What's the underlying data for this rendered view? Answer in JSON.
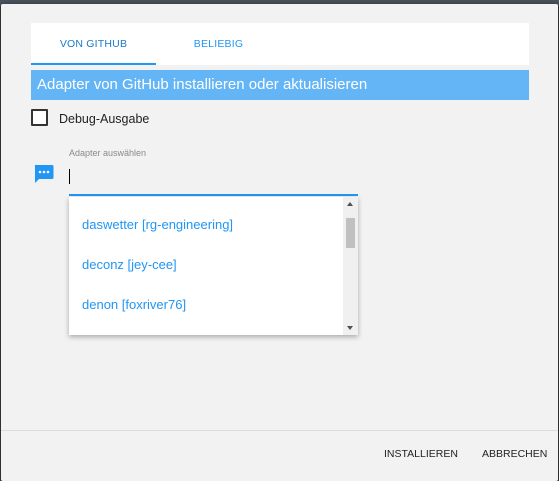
{
  "tabs": [
    {
      "label": "VON GITHUB",
      "active": true
    },
    {
      "label": "BELIEBIG",
      "active": false
    }
  ],
  "section": {
    "title": "Adapter von GitHub installieren oder aktualisieren"
  },
  "debug": {
    "label": "Debug-Ausgabe",
    "checked": false
  },
  "adapter_select": {
    "label": "Adapter auswählen",
    "value": "",
    "icon": "chat-bubble-icon",
    "options": [
      "daswetter [rg-engineering]",
      "deconz [jey-cee]",
      "denon [foxriver76]"
    ]
  },
  "footer": {
    "install_label": "INSTALLIEREN",
    "cancel_label": "ABBRECHEN"
  },
  "colors": {
    "accent": "#2196f3",
    "header_bg": "#64b5f6",
    "dialog_bg": "#f2f2f2"
  }
}
